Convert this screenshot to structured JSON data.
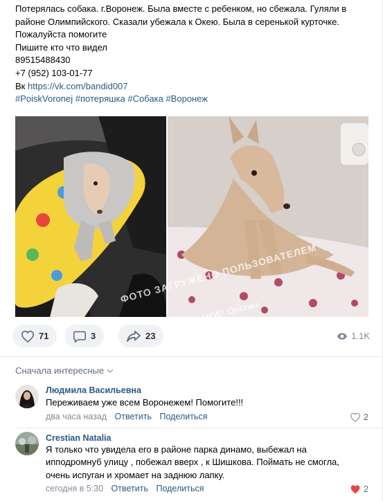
{
  "post": {
    "lines": [
      "Потерялась собака. г.Воронеж. Была вместе с ребенком, но сбежала. Гуляли в",
      "районе Олимпийского. Сказали убежала к Окею. Была в серенькой курточке.",
      "Пожалуйста помогите",
      "Пишите кто что видел",
      "89515488430",
      "+7 (952) 103-01-77"
    ],
    "vk_prefix": "Вк ",
    "vk_link": "https://vk.com/bandid007",
    "hashtags": [
      "#PoiskVoronej",
      "#потеряшка",
      "#Собака",
      "#Воронеж"
    ],
    "watermark_line1": "ФОТО ЗАГРУЖЕНО ПОЛЬЗОВАТЕЛЕМ",
    "watermark_line2": "«МОЁ! Online»"
  },
  "actions": {
    "likes": "71",
    "comments": "3",
    "shares": "23",
    "views": "1.1K"
  },
  "comments_header": {
    "sort_label": "Сначала интересные"
  },
  "comments": [
    {
      "author": "Людмила Васильевна",
      "text": "Переживаем уже всем Воронежем! Помогите!!!",
      "time": "два часа назад",
      "reply": "Ответить",
      "share": "Поделиться",
      "likes": "2",
      "liked": false
    },
    {
      "author": "Crestian Natalia",
      "text_lines": [
        "Я только что увидела его в районе парка динамо, выбежал на",
        "ипподромнуб улицу , побежал вверх , к Шишкова. Поймать не смогла,",
        "очень испуган и хромает на заднюю лапку."
      ],
      "time": "сегодня в 5:30",
      "reply": "Ответить",
      "share": "Поделиться",
      "likes": "2",
      "liked": true
    }
  ],
  "colors": {
    "link": "#2a5885",
    "muted": "#818c99",
    "pill_bg": "#f0f2f5",
    "liked": "#e64646"
  }
}
